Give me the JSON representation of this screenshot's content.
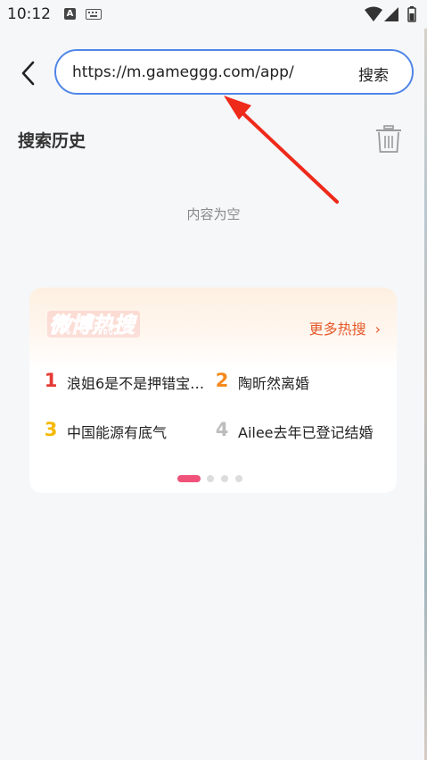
{
  "status_bar": {
    "time": "10:12",
    "notification_badge": "A",
    "icons": [
      "keyboard-icon",
      "wifi-icon",
      "signal-icon",
      "battery-icon"
    ]
  },
  "search": {
    "value": "https://m.gameggg.com/app/",
    "button_label": "搜索",
    "border_color": "#4f86e8"
  },
  "history": {
    "title": "搜索历史",
    "empty_text": "内容为空"
  },
  "hot_search": {
    "logo_text": "微博热搜",
    "more_label": "更多热搜",
    "more_chevron": "›",
    "items": [
      {
        "rank": "1",
        "text": "浪姐6是不是押错宝…",
        "rank_color": "#e53935"
      },
      {
        "rank": "2",
        "text": "陶昕然离婚",
        "rank_color": "#f5891f"
      },
      {
        "rank": "3",
        "text": "中国能源有底气",
        "rank_color": "#f5b800"
      },
      {
        "rank": "4",
        "text": "Ailee去年已登记结婚",
        "rank_color": "#bdbdbd"
      }
    ],
    "page_count": 4,
    "active_page": 1,
    "accent_color": "#f0527a"
  }
}
